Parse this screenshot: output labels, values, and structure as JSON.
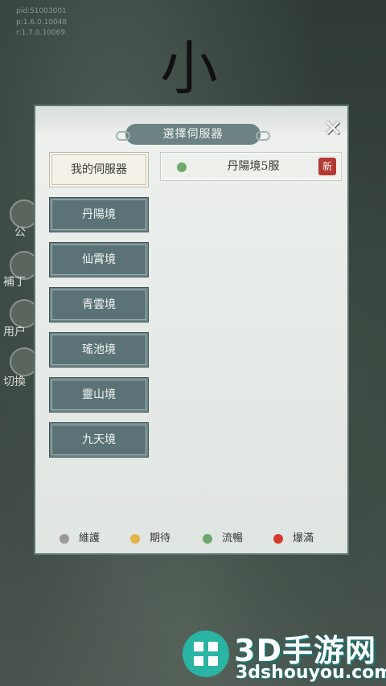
{
  "version_info": [
    "pid:51003001",
    "p:1.6.0.10048",
    "r:1.7.0.10069"
  ],
  "dialog": {
    "title": "選擇伺服器",
    "close_icon": "close-x-icon"
  },
  "tabs": {
    "my_servers": "我的伺服器",
    "regions": [
      "丹陽境",
      "仙霄境",
      "青雲境",
      "瑤池境",
      "靈山境",
      "九天境"
    ]
  },
  "servers": [
    {
      "name": "丹陽境5服",
      "status": "smooth",
      "status_color": "#6ea86a",
      "badge": "新"
    }
  ],
  "legend": [
    {
      "label": "維護",
      "color": "#9a9a9a"
    },
    {
      "label": "期待",
      "color": "#e0b64a"
    },
    {
      "label": "流暢",
      "color": "#6ea86a"
    },
    {
      "label": "爆滿",
      "color": "#d33a2f"
    }
  ],
  "background_labels": [
    "公",
    "補丁",
    "用户",
    "切換"
  ],
  "watermark": {
    "title": "3D手游网",
    "subtitle": "3dshouyou.com"
  }
}
